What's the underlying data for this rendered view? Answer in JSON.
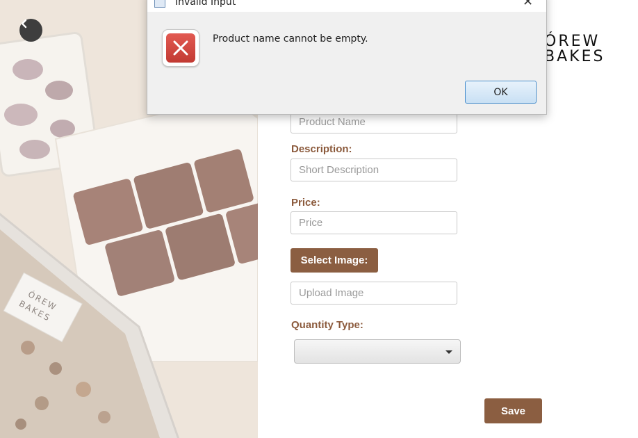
{
  "dialog": {
    "title": "Invalid Input",
    "message": "Product name cannot be empty.",
    "ok_label": "OK",
    "close_symbol": "✕",
    "icon": "error-icon"
  },
  "logo": {
    "line1": "ÓREW",
    "line2": "BAKES"
  },
  "form": {
    "product_name_placeholder": "Product Name",
    "description_label": "Description:",
    "description_placeholder": "Short Description",
    "price_label": "Price:",
    "price_placeholder": "Price",
    "select_image_label": "Select Image:",
    "upload_placeholder": "Upload Image",
    "quantity_type_label": "Quantity Type:",
    "quantity_type_value": "",
    "save_label": "Save"
  },
  "colors": {
    "accent_brown": "#8b5e41",
    "label_brown": "#8b5a3c",
    "error_red": "#d0463f",
    "ok_border_blue": "#4a8fcd"
  }
}
